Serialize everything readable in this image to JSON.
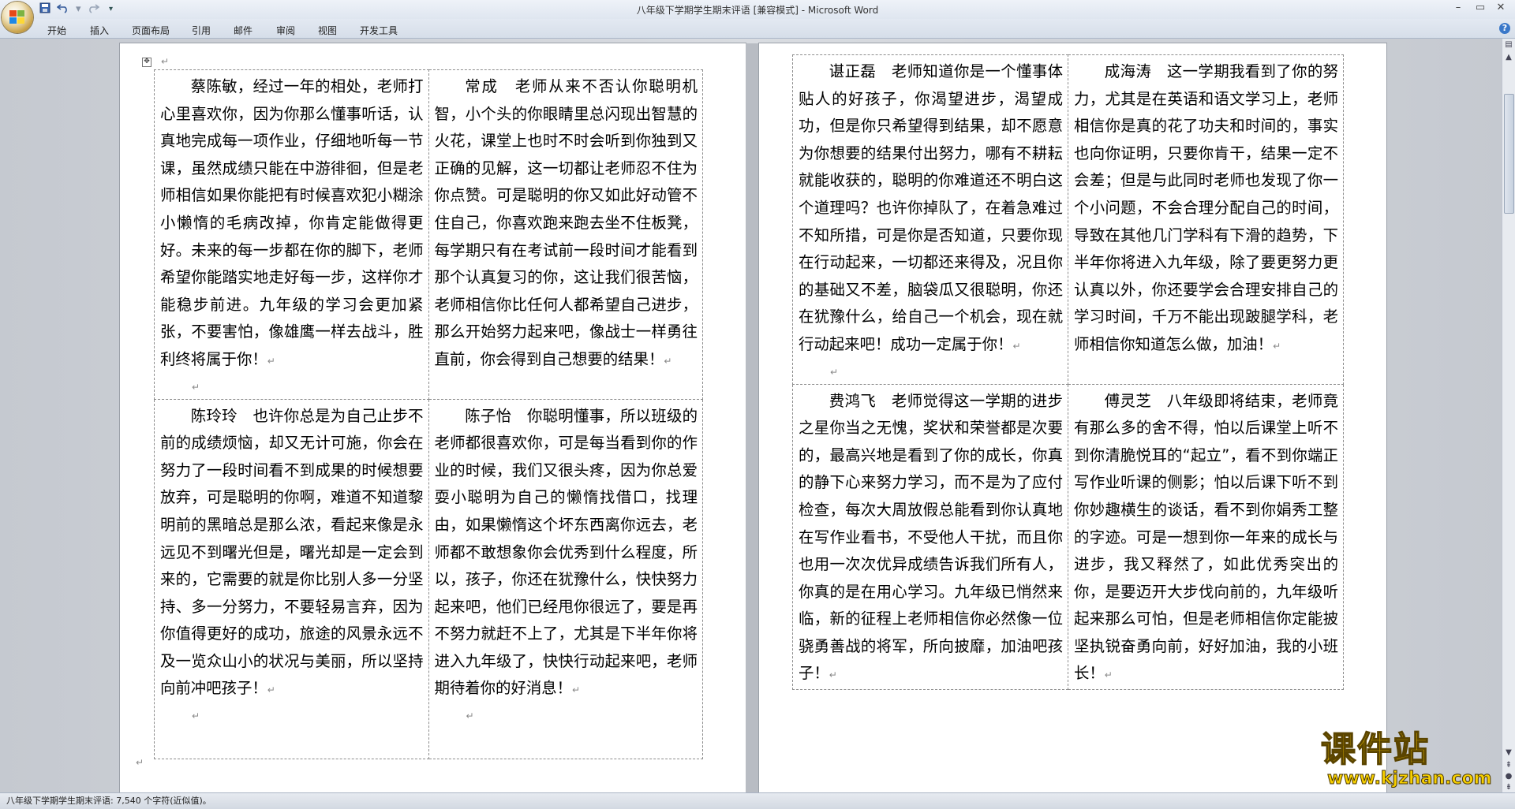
{
  "window": {
    "title": "八年级下学期学生期末评语 [兼容模式] - Microsoft Word",
    "minimize": "–",
    "restore": "▭",
    "close": "✕"
  },
  "quick_access": {
    "save": "save-icon",
    "undo": "undo-icon",
    "redo": "redo-icon",
    "customize": "▾"
  },
  "ribbon": {
    "tabs": [
      "开始",
      "插入",
      "页面布局",
      "引用",
      "邮件",
      "审阅",
      "视图",
      "开发工具"
    ],
    "help": "?"
  },
  "document": {
    "left_table": [
      [
        "蔡陈敏，经过一年的相处，老师打心里喜欢你，因为你那么懂事听话，认真地完成每一项作业，仔细地听每一节课，虽然成绩只能在中游徘徊，但是老师相信如果你能把有时候喜欢犯小糊涂小懒惰的毛病改掉，你肯定能做得更好。未来的每一步都在你的脚下，老师希望你能踏实地走好每一步，这样你才能稳步前进。九年级的学习会更加紧张，不要害怕，像雄鹰一样去战斗，胜利终将属于你！",
        "常成　老师从来不否认你聪明机智，小个头的你眼睛里总闪现出智慧的火花，课堂上也时不时会听到你独到又正确的见解，这一切都让老师忍不住为你点赞。可是聪明的你又如此好动管不住自己，你喜欢跑来跑去坐不住板凳，每学期只有在考试前一段时间才能看到那个认真复习的你，这让我们很苦恼，老师相信你比任何人都希望自己进步，那么开始努力起来吧，像战士一样勇往直前，你会得到自己想要的结果！"
      ],
      [
        "陈玲玲　也许你总是为自己止步不前的成绩烦恼，却又无计可施，你会在努力了一段时间看不到成果的时候想要放弃，可是聪明的你啊，难道不知道黎明前的黑暗总是那么浓，看起来像是永远见不到曙光但是，曙光却是一定会到来的，它需要的就是你比别人多一分坚持、多一分努力，不要轻易言弃，因为你值得更好的成功，旅途的风景永远不及一览众山小的状况与美丽，所以坚持向前冲吧孩子！",
        "陈子怡　你聪明懂事，所以班级的老师都很喜欢你，可是每当看到你的作业的时候，我们又很头疼，因为你总爱耍小聪明为自己的懒惰找借口，找理由，如果懒惰这个坏东西离你远去，老师都不敢想象你会优秀到什么程度，所以，孩子，你还在犹豫什么，快快努力起来吧，他们已经甩你很远了，要是再不努力就赶不上了，尤其是下半年你将进入九年级了，快快行动起来吧，老师期待着你的好消息！"
      ]
    ],
    "right_table": [
      [
        "谌正磊　老师知道你是一个懂事体贴人的好孩子，你渴望进步，渴望成功，但是你只希望得到结果，却不愿意为你想要的结果付出努力，哪有不耕耘就能收获的，聪明的你难道还不明白这个道理吗？也许你掉队了，在着急难过不知所措，可是你是否知道，只要你现在行动起来，一切都还来得及，况且你的基础又不差，脑袋瓜又很聪明，你还在犹豫什么，给自己一个机会，现在就行动起来吧！成功一定属于你！",
        "成海涛　这一学期我看到了你的努力，尤其是在英语和语文学习上，老师相信你是真的花了功夫和时间的，事实也向你证明，只要你肯干，结果一定不会差；但是与此同时老师也发现了你一个小问题，不会合理分配自己的时间，导致在其他几门学科有下滑的趋势，下半年你将进入九年级，除了要更努力更认真以外，你还要学会合理安排自己的学习时间，千万不能出现跛腿学科，老师相信你知道怎么做，加油！"
      ],
      [
        "费鸿飞　老师觉得这一学期的进步之星你当之无愧，奖状和荣誉都是次要的，最高兴地是看到了你的成长，你真的静下心来努力学习，而不是为了应付检查，每次大周放假总能看到你认真地在写作业看书，不受他人干扰，而且你也用一次次优异成绩告诉我们所有人，你真的是在用心学习。九年级已悄然来临，新的征程上老师相信你必然像一位骁勇善战的将军，所向披靡，加油吧孩子！",
        "傅灵芝　八年级即将结束，老师竟有那么多的舍不得，怕以后课堂上听不到你清脆悦耳的“起立”，看不到你端正写作业听课的侧影；怕以后课下听不到你妙趣横生的谈话，看不到你娟秀工整的字迹。可是一想到你一年来的成长与进步，我又释然了，如此优秀突出的你，是要迈开大步伐向前的，九年级听起来那么可怕，但是老师相信你定能披坚执锐奋勇向前，好好加油，我的小班长！"
      ]
    ]
  },
  "status_bar": {
    "text": "八年级下学期学生期末评语: 7,540 个字符(近似值)。"
  },
  "watermark": {
    "top": "课件站",
    "bottom": "www.kjzhan.com"
  }
}
